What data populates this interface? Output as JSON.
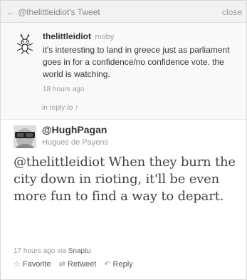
{
  "header": {
    "back_label": "@thelittleidiot's Tweet",
    "close_label": "close"
  },
  "original_tweet": {
    "username": "thelittleidiot",
    "source": "moby",
    "text": "it's interesting to land in greece just as parliament goes in for a confidence/no confidence vote. the world is watching.",
    "timestamp": "18 hours ago",
    "avatar_icon": "bug-icon"
  },
  "reply_context": {
    "label": "in reply to ↑"
  },
  "reply_tweet": {
    "username": "@HughPagan",
    "full_name": "Hugues de Payens",
    "text": "@thelittleidiot When they burn the city down in rioting, it'll be even more fun to find a way to depart.",
    "timestamp": "17 hours ago",
    "via_label": "via",
    "via_app": "Snaptu"
  },
  "actions": {
    "favorite": "Favorite",
    "retweet": "Retweet",
    "reply": "Reply"
  }
}
